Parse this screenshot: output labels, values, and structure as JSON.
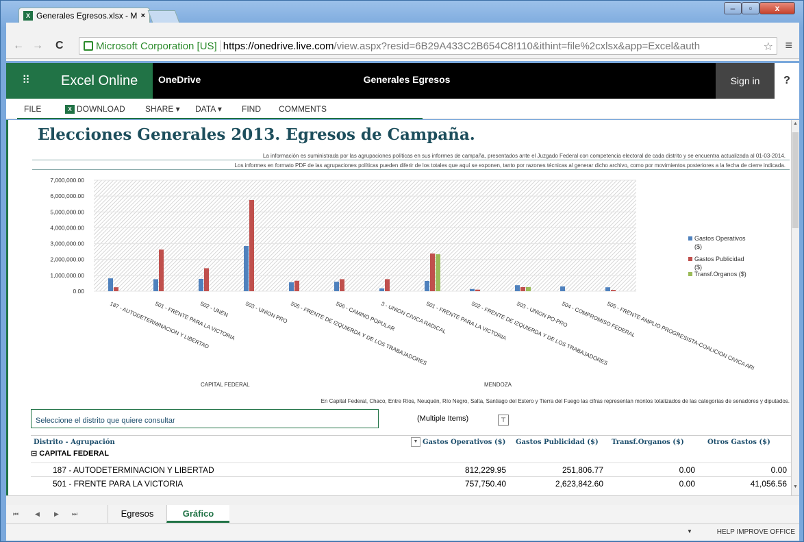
{
  "browser": {
    "tab_title": "Generales Egresos.xlsx - M",
    "tab_close": "×",
    "back": "←",
    "forward": "→",
    "reload": "C",
    "identity": "Microsoft Corporation [US]",
    "url_host": "https://onedrive.live.com",
    "url_rest": "/view.aspx?resid=6B29A433C2B654C8!110&ithint=file%2cxlsx&app=Excel&auth",
    "win_min": "–",
    "win_max": "▫",
    "win_close": "x"
  },
  "appbar": {
    "waffle": "⠿",
    "app_name": "Excel Online",
    "onedrive": "OneDrive",
    "doc_title": "Generales Egresos",
    "sign_in": "Sign in",
    "help": "?"
  },
  "ribbon": {
    "file": "FILE",
    "download": "DOWNLOAD",
    "share": "SHARE ▾",
    "data": "DATA ▾",
    "find": "FIND",
    "comments": "COMMENTS"
  },
  "sheet": {
    "title": "Elecciones Generales 2013. Egresos de Campaña.",
    "note1": "La información es suministrada por las agrupaciones políticas en sus informes de campaña, presentados ante el Juzgado Federal con competencia electoral de cada distrito y se encuentra actualizada al 01-03-2014.",
    "note2": "Los informes en formato PDF de las agrupaciones políticas pueden diferir de los totales que aquí se exponen, tanto por razones técnicas al generar dicho archivo, como por movimientos posteriores a la fecha de cierre indicada.",
    "region1": "CAPITAL FEDERAL",
    "region2": "MENDOZA",
    "footnote": "En Capital Federal, Chaco, Entre Ríos, Neuquén, Río Negro, Salta, Santiago del Estero y Tierra del Fuego las cifras representan montos totalizados de las categorías de senadores y diputados.",
    "select_prompt": "Seleccione el distrito que quiere consultar",
    "select_value": "(Multiple Items)",
    "filter_icon": "⊤"
  },
  "table": {
    "headers": [
      "Distrito - Agrupación",
      "Gastos Operativos ($)",
      "Gastos Publicidad ($)",
      "Transf.Organos ($)",
      "Otros Gastos ($)"
    ],
    "group": "⊟ CAPITAL FEDERAL",
    "rows": [
      {
        "name": "187 - AUTODETERMINACION Y LIBERTAD",
        "op": "812,229.95",
        "pub": "251,806.77",
        "transf": "0.00",
        "otros": "0.00"
      },
      {
        "name": "501 - FRENTE PARA LA VICTORIA",
        "op": "757,750.40",
        "pub": "2,623,842.60",
        "transf": "0.00",
        "otros": "41,056.56"
      }
    ]
  },
  "sheet_tabs": {
    "first": "⏮",
    "prev": "◀",
    "next": "▶",
    "last": "⏭",
    "tabs": [
      "Egresos",
      "Gráfico"
    ]
  },
  "status": {
    "arrow": "▼",
    "help": "HELP IMPROVE OFFICE"
  },
  "chart_data": {
    "type": "bar",
    "ylim": [
      0,
      7000000
    ],
    "yticks": [
      "7,000,000.00",
      "6,000,000.00",
      "5,000,000.00",
      "4,000,000.00",
      "3,000,000.00",
      "2,000,000.00",
      "1,000,000.00",
      "0.00"
    ],
    "categories": [
      "187 - AUTODETERMINACION Y LIBERTAD",
      "501 - FRENTE PARA LA VICTORIA",
      "502 - UNEN",
      "503 - UNION PRO",
      "505 - FRENTE DE IZQUIERDA Y DE LOS TRABAJADORES",
      "506 - CAMINO POPULAR",
      "3 - UNION CIVICA RADICAL",
      "501 - FRENTE PARA LA VICTORIA",
      "502 - FRENTE DE IZQUIERDA Y DE LOS TRABAJADORES",
      "503 - UNION PO-PRO",
      "504 - COMPROMISO FEDERAL",
      "505 - FRENTE AMPLIO PROGRESISTA-COALICION CIVICA ARI"
    ],
    "series": [
      {
        "name": "Gastos Operativos ($)",
        "color": "#4f81bd",
        "values": [
          812230,
          757750,
          780000,
          2850000,
          560000,
          600000,
          180000,
          650000,
          140000,
          380000,
          300000,
          250000
        ]
      },
      {
        "name": "Gastos Publicidad ($)",
        "color": "#c0504d",
        "values": [
          251807,
          2623843,
          1450000,
          5750000,
          660000,
          760000,
          760000,
          2380000,
          100000,
          260000,
          0,
          80000
        ]
      },
      {
        "name": "Transf.Organos ($)",
        "color": "#9bbb59",
        "values": [
          0,
          0,
          0,
          0,
          0,
          0,
          0,
          2330000,
          0,
          260000,
          0,
          0
        ]
      }
    ]
  }
}
